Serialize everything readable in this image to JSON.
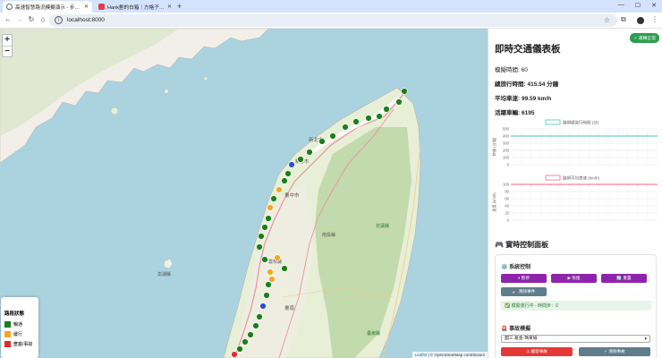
{
  "browser": {
    "tabs": [
      {
        "title": "高速智慧路況模擬演示 - 步驟流程",
        "active": true,
        "fav_color": "#5f6368"
      },
      {
        "title": "Hank劃的白箱｜方格子 vocus",
        "active": false,
        "fav_color": "#e53945"
      }
    ],
    "url": "localhost:8000"
  },
  "map": {
    "zoom_in": "+",
    "zoom_out": "−",
    "attribution_leaflet": "Leaflet",
    "attribution_rest": " | © OpenStreetMap contributors",
    "place_labels": {
      "taipei": "新北市",
      "hsinchu": "新竹市",
      "taichung": "臺中市",
      "nantou": "南投縣",
      "hualien": "花蓮縣",
      "yunlin": "雲林縣",
      "tainan": "臺南",
      "taitung": "臺東縣",
      "penghu": "澎湖縣"
    },
    "legend": {
      "title": "路段狀態",
      "items": [
        {
          "label": "暢通",
          "color": "#1a7f1a"
        },
        {
          "label": "緩行",
          "color": "#f5a623"
        },
        {
          "label": "壅塞/事故",
          "color": "#e32b2b"
        }
      ]
    }
  },
  "panel": {
    "running_badge": "✓ 運轉正常",
    "title": "即時交通儀表板",
    "sim_time_label": "模擬時間:",
    "sim_time_value": "60",
    "total_time_label": "總旅行時間:",
    "total_time_value": "415.54 分鐘",
    "avg_speed_label": "平均車速:",
    "avg_speed_value": "99.59 km/h",
    "active_label": "活躍車輛:",
    "active_value": "6195",
    "control_title": "🎮 實時控制面板",
    "system_control_title": "⚙️ 系統控制",
    "btn_pause": "⏸ 暫停",
    "btn_resume": "▶ 恢復",
    "btn_reset": "🔄 重置",
    "btn_clear": "🧹 清除事件",
    "status_text": "✅ 模擬運行中 - 時間步：0",
    "accident_title": "🚨 事故模擬",
    "accident_select": "國三 基金-瑪東線",
    "btn_create_accident": "⚠ 觸發事故",
    "btn_clear_accident": "✓ 清除事故"
  },
  "chart_data": [
    {
      "type": "line",
      "title": "",
      "series": [
        {
          "name": "路網總旅行時間 (分)",
          "values": [
            400,
            400,
            400,
            400,
            400,
            400,
            400,
            400,
            400,
            400,
            400,
            400,
            400,
            400,
            400,
            400
          ]
        }
      ],
      "ylabel": "時間 (分鐘)",
      "ylim": [
        0,
        500
      ],
      "yticks": [
        "500",
        "400",
        "300",
        "200",
        "100",
        "0"
      ],
      "color": "#4bc0c0",
      "legend": "top"
    },
    {
      "type": "line",
      "title": "",
      "series": [
        {
          "name": "路網平均車速 (km/h)",
          "values": [
            100,
            100,
            100,
            100,
            100,
            100,
            100,
            100,
            100,
            100,
            100,
            100,
            100,
            100,
            100,
            100
          ]
        }
      ],
      "ylabel": "速度 (km/h)",
      "ylim": [
        0,
        100
      ],
      "yticks": [
        "100",
        "80",
        "60",
        "40",
        "20",
        "0"
      ],
      "color": "#ff6384",
      "legend": "top"
    }
  ]
}
